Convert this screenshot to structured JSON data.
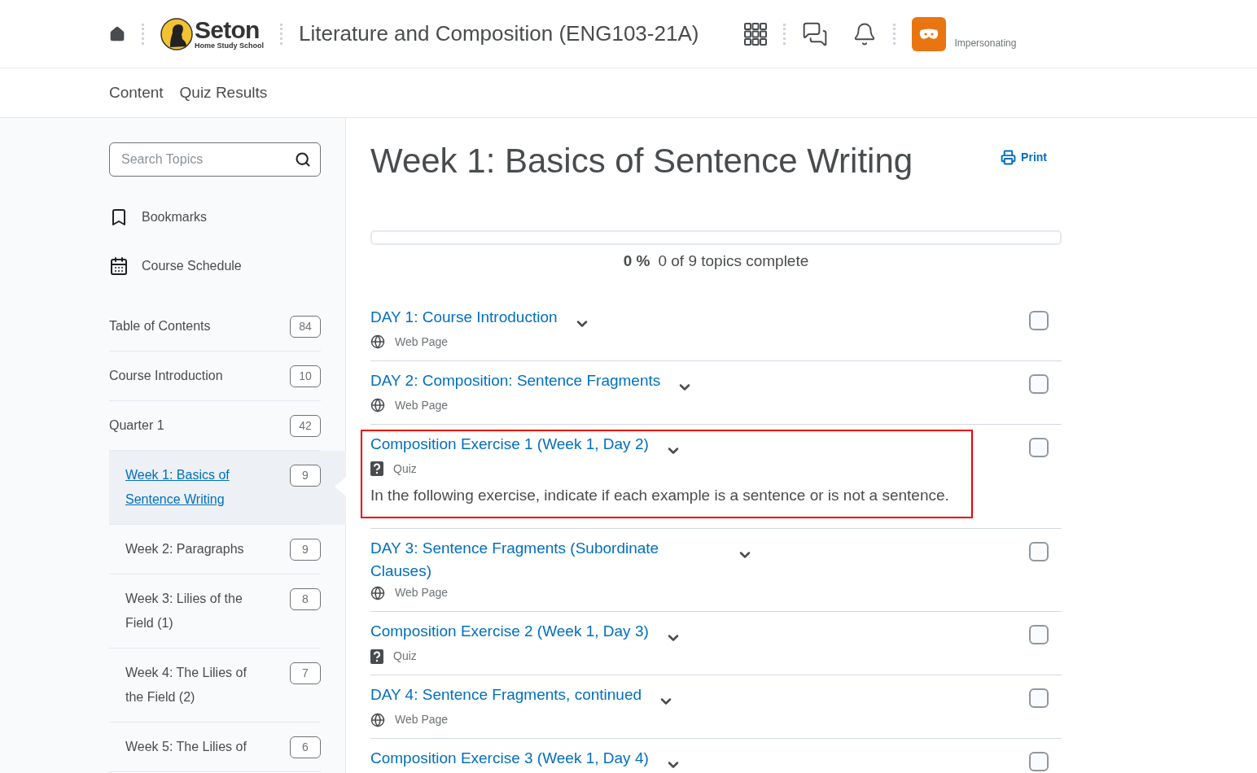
{
  "header": {
    "logo_name": "Seton",
    "logo_tagline": "Home Study School",
    "course_title": "Literature and Composition (ENG103-21A)",
    "impersonating_label": "Impersonating"
  },
  "nav": [
    {
      "label": "Content"
    },
    {
      "label": "Quiz Results"
    }
  ],
  "sidebar": {
    "search": {
      "placeholder": "Search Topics"
    },
    "links": [
      {
        "kind": "bookmark",
        "label": "Bookmarks"
      },
      {
        "kind": "calendar",
        "label": "Course Schedule"
      }
    ],
    "items": [
      {
        "label": "Table of Contents",
        "count": "84",
        "selected": false
      },
      {
        "label": "Course Introduction",
        "count": "10",
        "selected": false
      },
      {
        "label": "Quarter 1",
        "count": "42",
        "selected": false,
        "children": [
          {
            "label": "Week 1: Basics of Sentence Writing",
            "count": "9",
            "selected": true
          },
          {
            "label": "Week 2: Paragraphs",
            "count": "9",
            "selected": false
          },
          {
            "label": "Week 3: Lilies of the Field (1)",
            "count": "8",
            "selected": false
          },
          {
            "label": "Week 4: The Lilies of the Field (2)",
            "count": "7",
            "selected": false
          },
          {
            "label": "Week 5: The Lilies of",
            "count": "6",
            "selected": false
          }
        ]
      }
    ]
  },
  "main": {
    "title": "Week 1: Basics of Sentence Writing",
    "print_label": "Print",
    "progress": {
      "level": 0,
      "percent": "0 %",
      "summary": "0 of 9 topics complete"
    },
    "topics": [
      {
        "title": "DAY 1: Course Introduction",
        "kind": "webpage",
        "type_label": "Web Page",
        "checked": false,
        "highlighted": false
      },
      {
        "title": "DAY 2: Composition: Sentence Fragments",
        "kind": "webpage",
        "type_label": "Web Page",
        "checked": false,
        "highlighted": false
      },
      {
        "title": "Composition Exercise 1 (Week 1, Day 2)",
        "kind": "quiz",
        "type_label": "Quiz",
        "description": "In the following exercise, indicate if each example is a sentence or is not a sentence.",
        "checked": false,
        "highlighted": true
      },
      {
        "title": "DAY 3: Sentence Fragments (Subordinate Clauses)",
        "kind": "webpage",
        "type_label": "Web Page",
        "checked": false,
        "highlighted": false
      },
      {
        "title": "Composition Exercise 2 (Week 1, Day 3)",
        "kind": "quiz",
        "type_label": "Quiz",
        "checked": false,
        "highlighted": false
      },
      {
        "title": "DAY 4: Sentence Fragments, continued",
        "kind": "webpage",
        "type_label": "Web Page",
        "checked": false,
        "highlighted": false
      },
      {
        "title": "Composition Exercise 3 (Week 1, Day 4)",
        "checked": false,
        "highlighted": false
      }
    ]
  }
}
